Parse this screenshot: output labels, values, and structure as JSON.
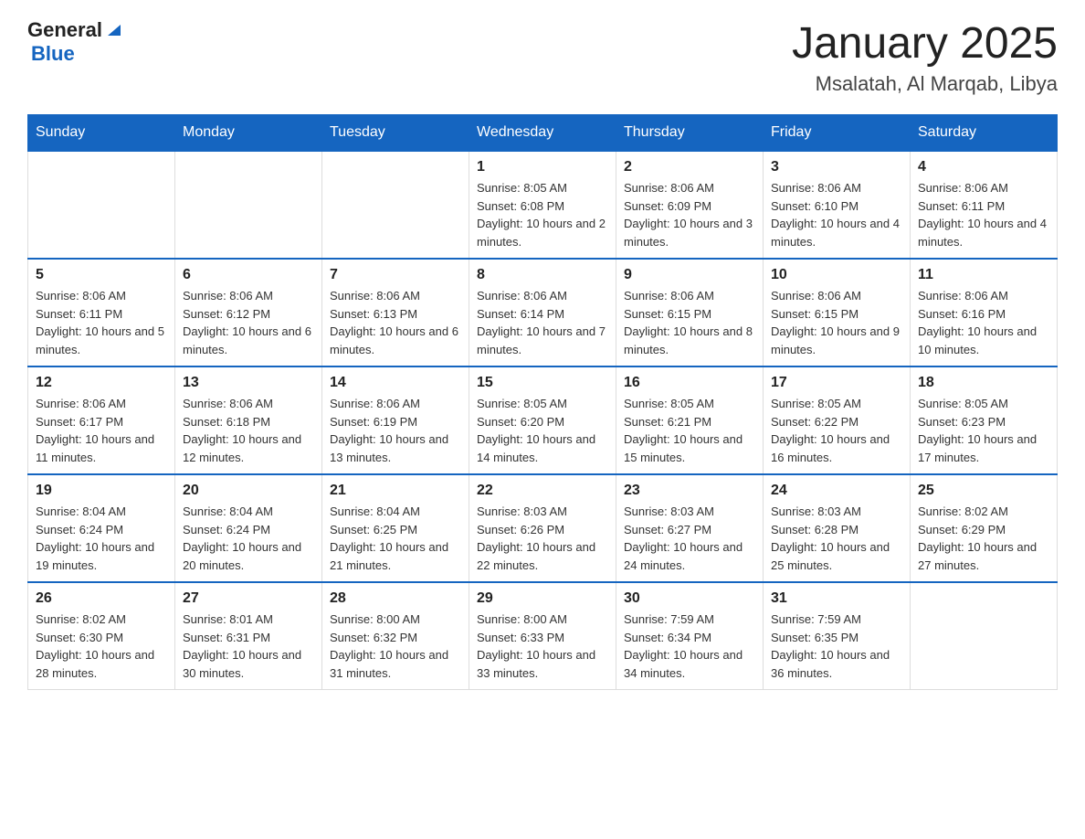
{
  "header": {
    "logo_general": "General",
    "logo_blue": "Blue",
    "title": "January 2025",
    "subtitle": "Msalatah, Al Marqab, Libya"
  },
  "weekdays": [
    "Sunday",
    "Monday",
    "Tuesday",
    "Wednesday",
    "Thursday",
    "Friday",
    "Saturday"
  ],
  "weeks": [
    [
      {
        "day": "",
        "info": ""
      },
      {
        "day": "",
        "info": ""
      },
      {
        "day": "",
        "info": ""
      },
      {
        "day": "1",
        "info": "Sunrise: 8:05 AM\nSunset: 6:08 PM\nDaylight: 10 hours and 2 minutes."
      },
      {
        "day": "2",
        "info": "Sunrise: 8:06 AM\nSunset: 6:09 PM\nDaylight: 10 hours and 3 minutes."
      },
      {
        "day": "3",
        "info": "Sunrise: 8:06 AM\nSunset: 6:10 PM\nDaylight: 10 hours and 4 minutes."
      },
      {
        "day": "4",
        "info": "Sunrise: 8:06 AM\nSunset: 6:11 PM\nDaylight: 10 hours and 4 minutes."
      }
    ],
    [
      {
        "day": "5",
        "info": "Sunrise: 8:06 AM\nSunset: 6:11 PM\nDaylight: 10 hours and 5 minutes."
      },
      {
        "day": "6",
        "info": "Sunrise: 8:06 AM\nSunset: 6:12 PM\nDaylight: 10 hours and 6 minutes."
      },
      {
        "day": "7",
        "info": "Sunrise: 8:06 AM\nSunset: 6:13 PM\nDaylight: 10 hours and 6 minutes."
      },
      {
        "day": "8",
        "info": "Sunrise: 8:06 AM\nSunset: 6:14 PM\nDaylight: 10 hours and 7 minutes."
      },
      {
        "day": "9",
        "info": "Sunrise: 8:06 AM\nSunset: 6:15 PM\nDaylight: 10 hours and 8 minutes."
      },
      {
        "day": "10",
        "info": "Sunrise: 8:06 AM\nSunset: 6:15 PM\nDaylight: 10 hours and 9 minutes."
      },
      {
        "day": "11",
        "info": "Sunrise: 8:06 AM\nSunset: 6:16 PM\nDaylight: 10 hours and 10 minutes."
      }
    ],
    [
      {
        "day": "12",
        "info": "Sunrise: 8:06 AM\nSunset: 6:17 PM\nDaylight: 10 hours and 11 minutes."
      },
      {
        "day": "13",
        "info": "Sunrise: 8:06 AM\nSunset: 6:18 PM\nDaylight: 10 hours and 12 minutes."
      },
      {
        "day": "14",
        "info": "Sunrise: 8:06 AM\nSunset: 6:19 PM\nDaylight: 10 hours and 13 minutes."
      },
      {
        "day": "15",
        "info": "Sunrise: 8:05 AM\nSunset: 6:20 PM\nDaylight: 10 hours and 14 minutes."
      },
      {
        "day": "16",
        "info": "Sunrise: 8:05 AM\nSunset: 6:21 PM\nDaylight: 10 hours and 15 minutes."
      },
      {
        "day": "17",
        "info": "Sunrise: 8:05 AM\nSunset: 6:22 PM\nDaylight: 10 hours and 16 minutes."
      },
      {
        "day": "18",
        "info": "Sunrise: 8:05 AM\nSunset: 6:23 PM\nDaylight: 10 hours and 17 minutes."
      }
    ],
    [
      {
        "day": "19",
        "info": "Sunrise: 8:04 AM\nSunset: 6:24 PM\nDaylight: 10 hours and 19 minutes."
      },
      {
        "day": "20",
        "info": "Sunrise: 8:04 AM\nSunset: 6:24 PM\nDaylight: 10 hours and 20 minutes."
      },
      {
        "day": "21",
        "info": "Sunrise: 8:04 AM\nSunset: 6:25 PM\nDaylight: 10 hours and 21 minutes."
      },
      {
        "day": "22",
        "info": "Sunrise: 8:03 AM\nSunset: 6:26 PM\nDaylight: 10 hours and 22 minutes."
      },
      {
        "day": "23",
        "info": "Sunrise: 8:03 AM\nSunset: 6:27 PM\nDaylight: 10 hours and 24 minutes."
      },
      {
        "day": "24",
        "info": "Sunrise: 8:03 AM\nSunset: 6:28 PM\nDaylight: 10 hours and 25 minutes."
      },
      {
        "day": "25",
        "info": "Sunrise: 8:02 AM\nSunset: 6:29 PM\nDaylight: 10 hours and 27 minutes."
      }
    ],
    [
      {
        "day": "26",
        "info": "Sunrise: 8:02 AM\nSunset: 6:30 PM\nDaylight: 10 hours and 28 minutes."
      },
      {
        "day": "27",
        "info": "Sunrise: 8:01 AM\nSunset: 6:31 PM\nDaylight: 10 hours and 30 minutes."
      },
      {
        "day": "28",
        "info": "Sunrise: 8:00 AM\nSunset: 6:32 PM\nDaylight: 10 hours and 31 minutes."
      },
      {
        "day": "29",
        "info": "Sunrise: 8:00 AM\nSunset: 6:33 PM\nDaylight: 10 hours and 33 minutes."
      },
      {
        "day": "30",
        "info": "Sunrise: 7:59 AM\nSunset: 6:34 PM\nDaylight: 10 hours and 34 minutes."
      },
      {
        "day": "31",
        "info": "Sunrise: 7:59 AM\nSunset: 6:35 PM\nDaylight: 10 hours and 36 minutes."
      },
      {
        "day": "",
        "info": ""
      }
    ]
  ]
}
